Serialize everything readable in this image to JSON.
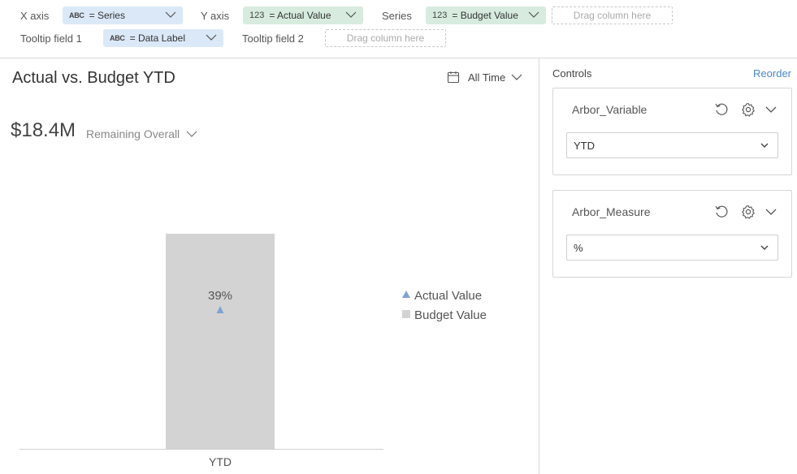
{
  "shelves": {
    "x_axis": {
      "label": "X axis",
      "type_badge": "ABC",
      "field": "= Series"
    },
    "y_axis": {
      "label": "Y axis",
      "type_badge": "123",
      "field": "= Actual Value"
    },
    "series": {
      "label": "Series",
      "type_badge": "123",
      "field": "= Budget Value"
    },
    "series_drop": {
      "placeholder": "Drag column here"
    },
    "tooltip1": {
      "label": "Tooltip field 1",
      "type_badge": "ABC",
      "field": "= Data Label"
    },
    "tooltip2": {
      "label": "Tooltip field 2",
      "placeholder": "Drag column here"
    }
  },
  "chart_panel": {
    "title": "Actual vs. Budget YTD",
    "date_filter": "All Time",
    "kpi_value": "$18.4M",
    "kpi_label": "Remaining Overall"
  },
  "chart_data": {
    "type": "bar",
    "categories": [
      "YTD"
    ],
    "series": [
      {
        "name": "Budget Value",
        "kind": "bar",
        "values": [
          100
        ],
        "color": "#d3d3d3"
      },
      {
        "name": "Actual Value",
        "kind": "marker",
        "marker": "triangle",
        "values": [
          39
        ],
        "color": "#7fa3d3"
      }
    ],
    "data_labels": [
      "39%"
    ],
    "title": "",
    "xlabel": "",
    "ylabel": "",
    "ylim": [
      0,
      100
    ],
    "grid": false,
    "legend_position": "right"
  },
  "controls_panel": {
    "title": "Controls",
    "reorder_label": "Reorder",
    "controls": [
      {
        "name": "Arbor_Variable",
        "value": "YTD"
      },
      {
        "name": "Arbor_Measure",
        "value": "%"
      }
    ]
  },
  "icons": {
    "type_text": "abc-type-icon",
    "type_number": "number-type-icon",
    "calendar": "calendar-icon",
    "reset": "reset-icon",
    "settings": "gear-icon",
    "collapse": "chevron-down-icon"
  },
  "colors": {
    "pill_text_field": "#dbe8f7",
    "pill_number_field": "#d7ecdf",
    "bar": "#d3d3d3",
    "marker": "#7fa3d3",
    "link": "#4a86c8"
  }
}
